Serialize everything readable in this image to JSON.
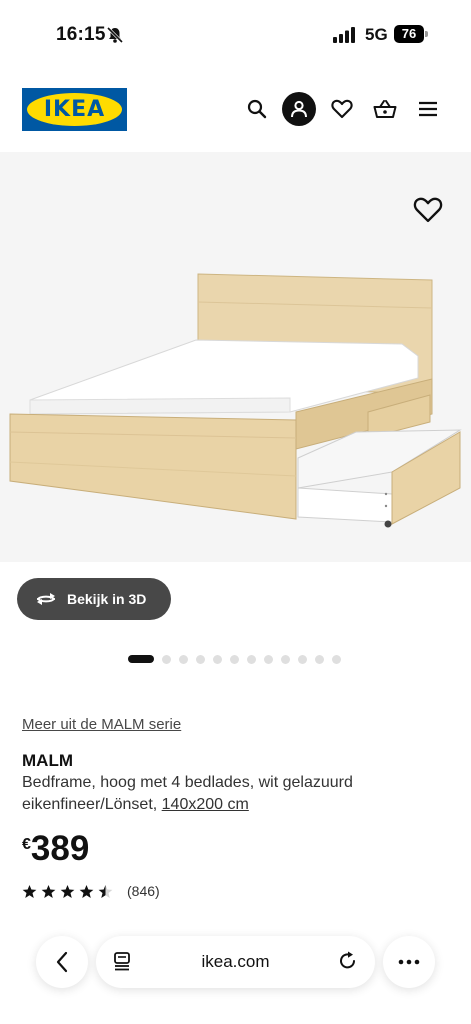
{
  "status_bar": {
    "time": "16:15",
    "network": "5G",
    "battery": "76"
  },
  "header": {
    "logo_text": "IKEA",
    "icons": [
      "search-icon",
      "account-icon",
      "heart-icon",
      "basket-icon",
      "menu-icon"
    ]
  },
  "gallery": {
    "view_3d_label": "Bekijk in 3D",
    "dot_count": 12,
    "active_dot": 0
  },
  "product": {
    "series_link": "Meer uit de MALM serie",
    "name": "MALM",
    "description": "Bedframe, hoog met 4 bedlades, wit gelazuurd eikenfineer/Lönset,",
    "size": "140x200 cm",
    "currency": "€",
    "price": "389",
    "rating": 4.5,
    "rating_max": 5,
    "review_count": "(846)"
  },
  "browser": {
    "url": "ikea.com"
  },
  "colors": {
    "ikea_blue": "#0058a3",
    "ikea_yellow": "#ffdb00",
    "pill_dark": "#484848",
    "wood": "#e9d3a6"
  }
}
